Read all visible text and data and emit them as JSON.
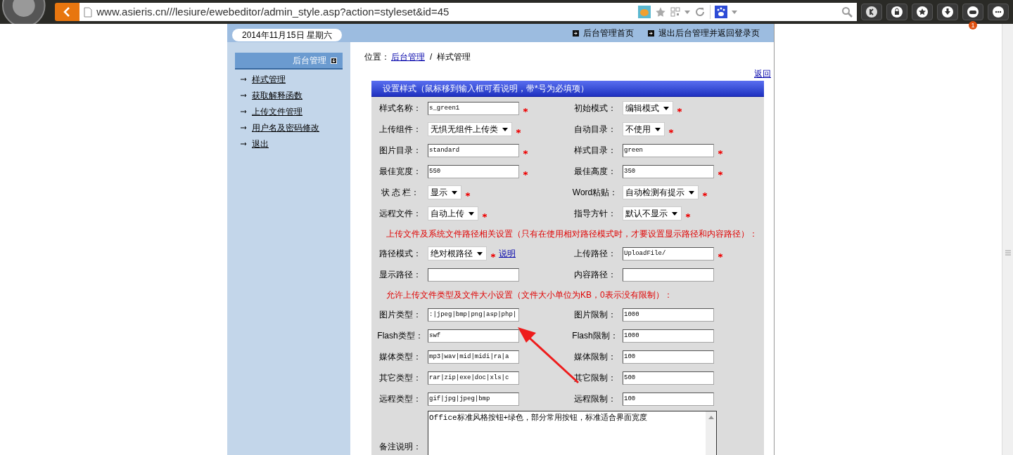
{
  "browser": {
    "url": "www.asieris.cn///lesiure/ewebeditor/admin_style.asp?action=styleset&id=45",
    "notification_count": "1"
  },
  "header": {
    "date": "2014年11月15日  星期六",
    "links": [
      "后台管理首页",
      "退出后台管理并返回登录页"
    ]
  },
  "sidebar": {
    "title": "后台管理",
    "items": [
      "样式管理",
      "获取解释函数",
      "上传文件管理",
      "用户名及密码修改",
      "退出"
    ]
  },
  "breadcrumb": {
    "prefix": "位置：",
    "link": "后台管理",
    "separator": "/",
    "current": "样式管理"
  },
  "back_link": "返回",
  "form": {
    "title": "设置样式（鼠标移到输入框可看说明，带*号为必填项）",
    "items": [
      {
        "kind": "row",
        "fields": [
          {
            "label": "样式名称：",
            "kind": "text",
            "value": "s_green1",
            "required": true
          },
          {
            "label": "初始模式：",
            "kind": "select",
            "value": "编辑模式",
            "required": true
          }
        ]
      },
      {
        "kind": "row",
        "fields": [
          {
            "label": "上传组件：",
            "kind": "select",
            "value": "无惧无组件上传类",
            "required": true
          },
          {
            "label": "自动目录：",
            "kind": "select",
            "value": "不使用",
            "required": true
          }
        ]
      },
      {
        "kind": "row",
        "fields": [
          {
            "label": "图片目录：",
            "kind": "text",
            "value": "standard",
            "required": true
          },
          {
            "label": "样式目录：",
            "kind": "text",
            "value": "green",
            "required": true
          }
        ]
      },
      {
        "kind": "row",
        "fields": [
          {
            "label": "最佳宽度：",
            "kind": "text",
            "value": "550",
            "required": true
          },
          {
            "label": "最佳高度：",
            "kind": "text",
            "value": "350",
            "required": true
          }
        ]
      },
      {
        "kind": "row",
        "fields": [
          {
            "label": "状 态 栏：",
            "kind": "select",
            "value": "显示",
            "required": true
          },
          {
            "label": "Word粘贴：",
            "kind": "select",
            "value": "自动检测有提示",
            "required": true
          }
        ]
      },
      {
        "kind": "row",
        "fields": [
          {
            "label": "远程文件：",
            "kind": "select",
            "value": "自动上传",
            "required": true
          },
          {
            "label": "指导方针：",
            "kind": "select",
            "value": "默认不显示",
            "required": true
          }
        ]
      },
      {
        "kind": "note",
        "text": "上传文件及系统文件路径相关设置（只有在使用相对路径模式时，才要设置显示路径和内容路径）："
      },
      {
        "kind": "row",
        "fields": [
          {
            "label": "路径模式：",
            "kind": "select",
            "value": "绝对根路径",
            "required": true,
            "link": "说明"
          },
          {
            "label": "上传路径：",
            "kind": "text",
            "value": "UploadFile/",
            "required": true
          }
        ]
      },
      {
        "kind": "row",
        "fields": [
          {
            "label": "显示路径：",
            "kind": "text",
            "required": false
          },
          {
            "label": "内容路径：",
            "kind": "text",
            "required": false
          }
        ]
      },
      {
        "kind": "note",
        "text": "允许上传文件类型及文件大小设置（文件大小单位为KB，0表示没有限制）："
      },
      {
        "kind": "row",
        "fields": [
          {
            "label": "图片类型：",
            "kind": "text",
            "value": ":|jpeg|bmp|png|asp|php|",
            "required": false
          },
          {
            "label": "图片限制：",
            "kind": "text",
            "value": "1000",
            "required": false
          }
        ]
      },
      {
        "kind": "row",
        "fields": [
          {
            "label": "Flash类型：",
            "kind": "text",
            "value": "swf",
            "required": false
          },
          {
            "label": "Flash限制：",
            "kind": "text",
            "value": "1000",
            "required": false
          }
        ]
      },
      {
        "kind": "row",
        "fields": [
          {
            "label": "媒体类型：",
            "kind": "text",
            "value": "mp3|wav|mid|midi|ra|a",
            "required": false
          },
          {
            "label": "媒体限制：",
            "kind": "text",
            "value": "100",
            "required": false
          }
        ]
      },
      {
        "kind": "row",
        "fields": [
          {
            "label": "其它类型：",
            "kind": "text",
            "value": "rar|zip|exe|doc|xls|c",
            "required": false
          },
          {
            "label": "其它限制：",
            "kind": "text",
            "value": "500",
            "required": false
          }
        ]
      },
      {
        "kind": "row",
        "fields": [
          {
            "label": "远程类型：",
            "kind": "text",
            "value": "gif|jpg|jpeg|bmp",
            "required": false
          },
          {
            "label": "远程限制：",
            "kind": "text",
            "value": "100",
            "required": false
          }
        ]
      },
      {
        "kind": "textarea",
        "label": "备注说明：",
        "value": "Office标准风格按钮+绿色，部分常用按钮，标准适合界面宽度"
      }
    ]
  }
}
